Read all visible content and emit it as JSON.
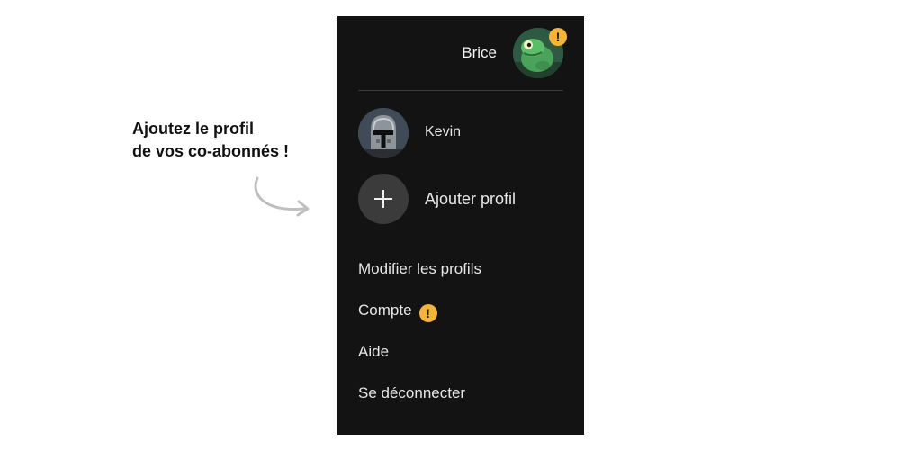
{
  "annotation": {
    "line1": "Ajoutez le profil",
    "line2": "de vos co-abonnés !"
  },
  "header": {
    "user_name": "Brice",
    "alert_glyph": "!"
  },
  "profiles": [
    {
      "name": "Kevin",
      "avatar": "helmet-avatar"
    },
    {
      "name": "Ajouter profil",
      "icon": "plus-icon"
    }
  ],
  "menu": {
    "items": [
      {
        "label": "Modifier les profils"
      },
      {
        "label": "Compte",
        "badge": "!"
      },
      {
        "label": "Aide"
      },
      {
        "label": "Se déconnecter"
      }
    ]
  },
  "colors": {
    "panel_bg": "#131313",
    "alert": "#f4b43a",
    "text": "#e6e6e6"
  }
}
